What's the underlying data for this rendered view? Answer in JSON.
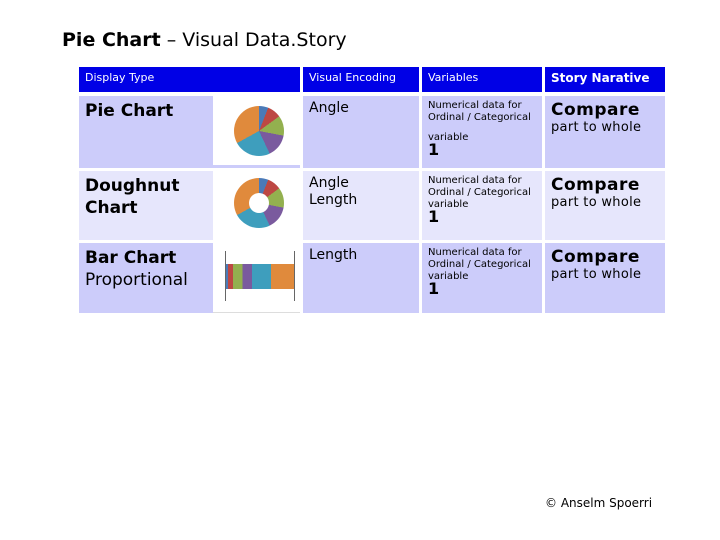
{
  "title": {
    "bold": "Pie Chart",
    "rest": " – Visual Data.Story"
  },
  "headers": [
    "Display Type",
    "Visual Encoding",
    "Variables",
    "Story Narative"
  ],
  "rows": [
    {
      "name": "Pie Chart",
      "sub": "",
      "encoding": [
        "Angle",
        ""
      ],
      "variables": [
        "Numerical data for",
        "Ordinal  / Categorical",
        "variable"
      ],
      "count": "1",
      "narrative": "Compare",
      "narrative_sub": "part to whole",
      "icon": "pie-chart-icon"
    },
    {
      "name": "Doughnut",
      "name2": "Chart",
      "encoding": [
        "Angle",
        "Length"
      ],
      "variables": [
        "Numerical data for",
        "Ordinal  / Categorical",
        "variable"
      ],
      "count": "1",
      "narrative": "Compare",
      "narrative_sub": "part to whole",
      "icon": "doughnut-chart-icon"
    },
    {
      "name": "Bar Chart",
      "sub": "Proportional",
      "encoding": [
        "Length",
        ""
      ],
      "variables": [
        "Numerical data for",
        "Ordinal  / Categorical",
        "variable"
      ],
      "count": "1",
      "narrative": "Compare",
      "narrative_sub": "part to whole",
      "icon": "stacked-bar-icon"
    }
  ],
  "colors": {
    "header": "#0000e6",
    "row_dark": "#ccccfa",
    "row_light": "#e6e6fc",
    "slices": [
      "#4a7ab8",
      "#bd4843",
      "#93b04f",
      "#7a5a9e",
      "#3e9ebd",
      "#e08a3c"
    ]
  },
  "footer": "© Anselm Spoerri"
}
